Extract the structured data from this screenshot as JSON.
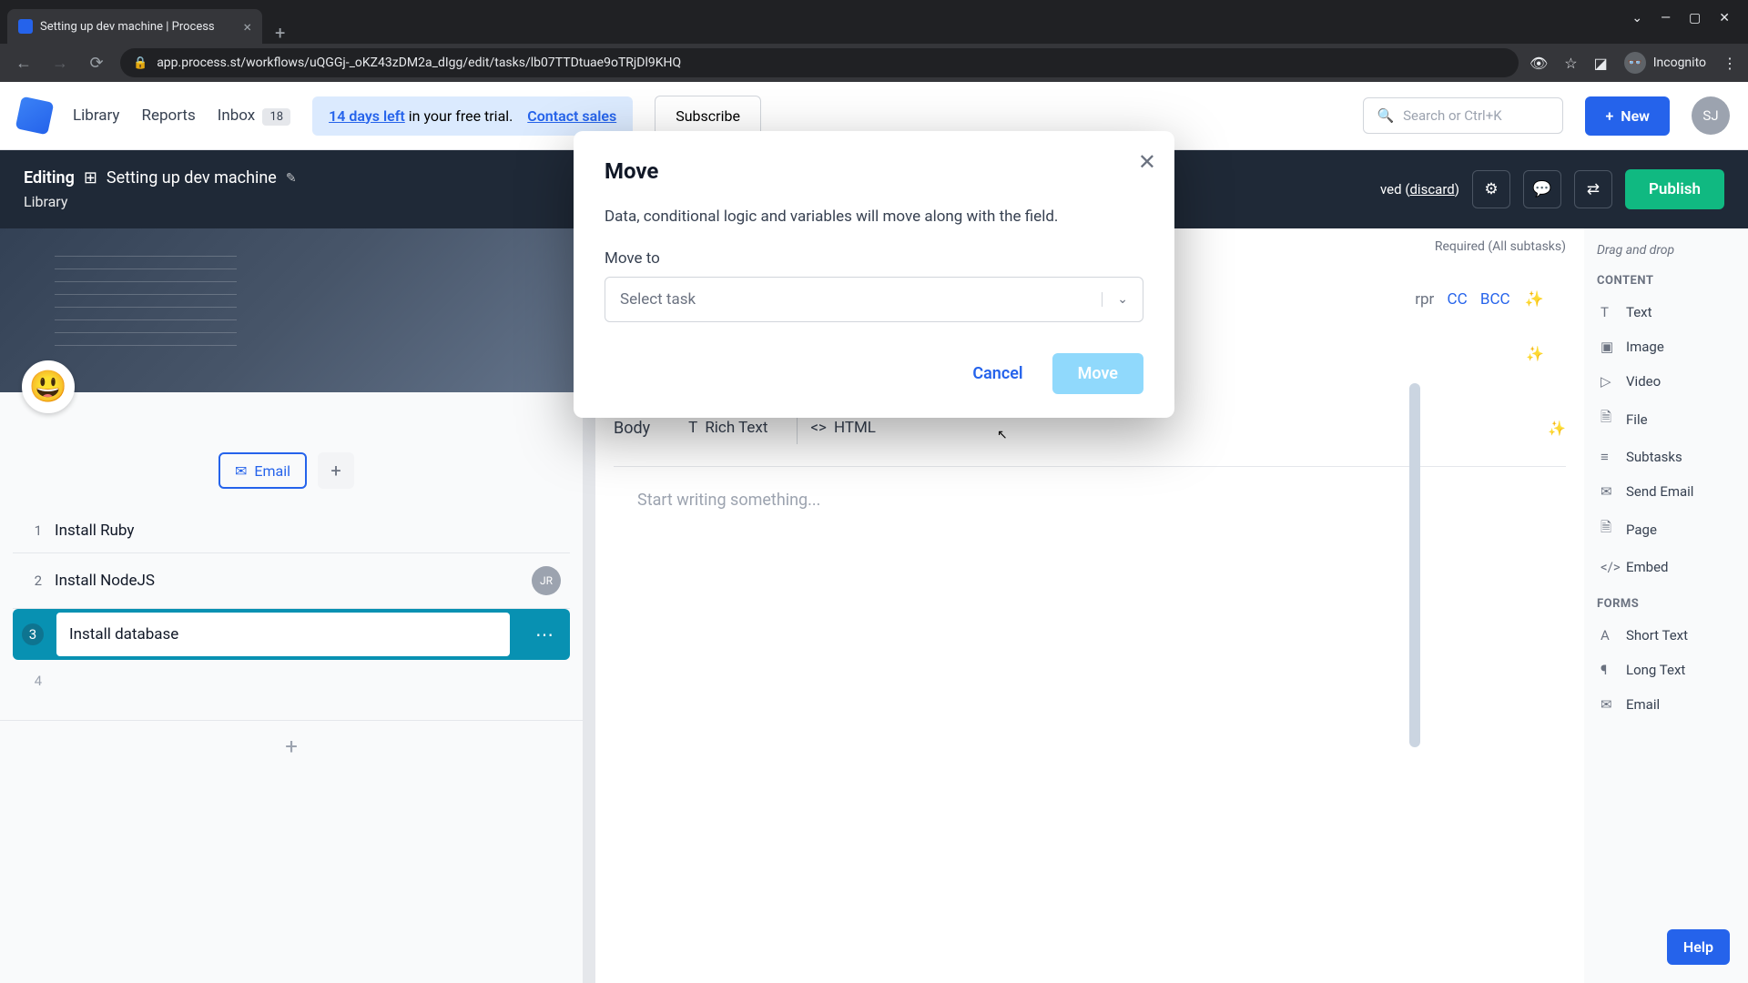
{
  "browser": {
    "tab_title": "Setting up dev machine | Process",
    "url": "app.process.st/workflows/uQGGj-_oKZ43zDM2a_dIgg/edit/tasks/lb07TTDtuae9oTRjDl9KHQ",
    "incognito_label": "Incognito"
  },
  "header": {
    "nav": {
      "library": "Library",
      "reports": "Reports",
      "inbox": "Inbox",
      "inbox_count": "18"
    },
    "trial": {
      "days": "14 days left",
      "suffix": "in your free trial.",
      "contact": "Contact sales"
    },
    "subscribe": "Subscribe",
    "search_placeholder": "Search or Ctrl+K",
    "new_btn": "New",
    "avatar": "SJ"
  },
  "editing_bar": {
    "editing_label": "Editing",
    "workflow_name": "Setting up dev machine",
    "crumb": "Library",
    "saved_prefix": "ved (",
    "discard": "discard",
    "saved_suffix": ")",
    "publish": "Publish"
  },
  "left": {
    "emoji": "😃",
    "email_tag": "Email",
    "tasks": [
      {
        "num": "1",
        "text": "Install Ruby"
      },
      {
        "num": "2",
        "text": "Install NodeJS",
        "assignee": "JR"
      },
      {
        "num": "3",
        "text": "Install database"
      },
      {
        "num": "4",
        "text": ""
      }
    ]
  },
  "detail": {
    "required": "Required (All subtasks)",
    "rpr": "rpr",
    "cc": "CC",
    "bcc": "BCC",
    "body_label": "Body",
    "rich_text": "Rich Text",
    "html": "HTML",
    "editor_placeholder": "Start writing something..."
  },
  "sidebar": {
    "drag_hint": "Drag and drop",
    "content_label": "CONTENT",
    "forms_label": "FORMS",
    "content_items": [
      {
        "icon": "T",
        "label": "Text"
      },
      {
        "icon": "▣",
        "label": "Image"
      },
      {
        "icon": "▷",
        "label": "Video"
      },
      {
        "icon": "🗎",
        "label": "File"
      },
      {
        "icon": "≡",
        "label": "Subtasks"
      },
      {
        "icon": "✉",
        "label": "Send Email"
      },
      {
        "icon": "🗎",
        "label": "Page"
      },
      {
        "icon": "</>",
        "label": "Embed"
      }
    ],
    "forms_items": [
      {
        "icon": "A",
        "label": "Short Text"
      },
      {
        "icon": "¶",
        "label": "Long Text"
      },
      {
        "icon": "✉",
        "label": "Email"
      }
    ]
  },
  "modal": {
    "title": "Move",
    "description": "Data, conditional logic and variables will move along with the field.",
    "move_to_label": "Move to",
    "select_placeholder": "Select task",
    "cancel": "Cancel",
    "confirm": "Move"
  },
  "help": "Help"
}
